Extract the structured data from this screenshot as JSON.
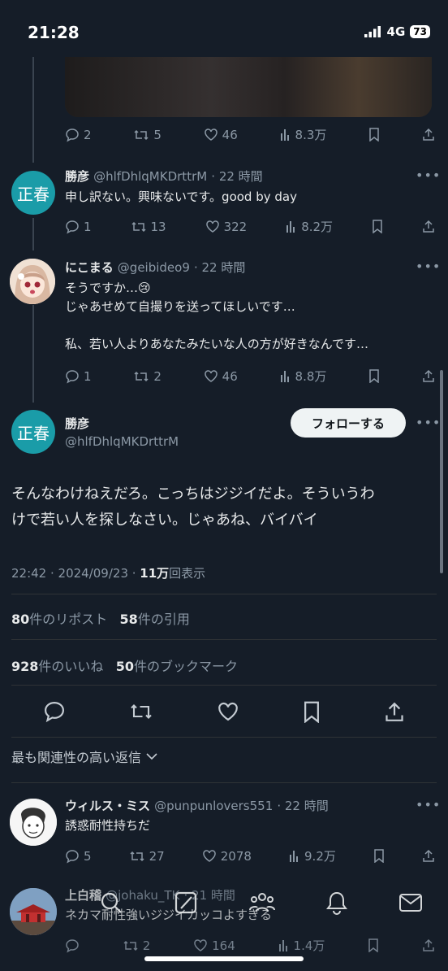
{
  "status": {
    "time": "21:28",
    "network": "4G",
    "battery": "73"
  },
  "tweet1": {
    "replies": "2",
    "reposts": "5",
    "likes": "46",
    "views": "8.3万"
  },
  "reply1": {
    "avatar_text": "正春",
    "name": "勝彦",
    "handle": "@hlfDhlqMKDrttrM",
    "time": "· 22 時間",
    "text": "申し訳ない。興味ないです。good by day",
    "replies": "1",
    "reposts": "13",
    "likes": "322",
    "views": "8.2万"
  },
  "reply2": {
    "name": "にこまる",
    "handle": "@geibideo9",
    "time": "· 22 時間",
    "line1": "そうですか…😢",
    "line2": "じゃあせめて自撮りを送ってほしいです…",
    "line3": "私、若い人よりあなたみたいな人の方が好きなんです…",
    "replies": "1",
    "reposts": "2",
    "likes": "46",
    "views": "8.8万"
  },
  "main": {
    "avatar_text": "正春",
    "name": "勝彦",
    "handle": "@hlfDhlqMKDrttrM",
    "follow_label": "フォローする",
    "text_line1": "そんなわけねえだろ。こっちはジジイだよ。そういうわ",
    "text_line2": "けで若い人を探しなさい。じゃあね、バイバイ",
    "timestamp": "22:42 · 2024/09/23 · ",
    "views_num": "11万",
    "views_label": "回表示",
    "reposts_num": "80",
    "reposts_label": "件のリポスト",
    "quotes_num": "58",
    "quotes_label": "件の引用",
    "likes_num": "928",
    "likes_label": "件のいいね",
    "bookmarks_num": "50",
    "bookmarks_label": "件のブックマーク"
  },
  "sort": {
    "label": "最も関連性の高い返信"
  },
  "reply3": {
    "name": "ウィルス・ミス",
    "handle": "@punpunlovers551",
    "time": "· 22 時間",
    "text": "誘惑耐性持ちだ",
    "replies": "5",
    "reposts": "27",
    "likes": "2078",
    "views": "9.2万"
  },
  "reply4": {
    "name": "上白稽",
    "handle": "@johaku_TK",
    "time": "· 21 時間",
    "text": "ネカマ耐性強いジジイカッコよすぎる",
    "reposts": "2",
    "likes": "164",
    "views": "1.4万"
  }
}
